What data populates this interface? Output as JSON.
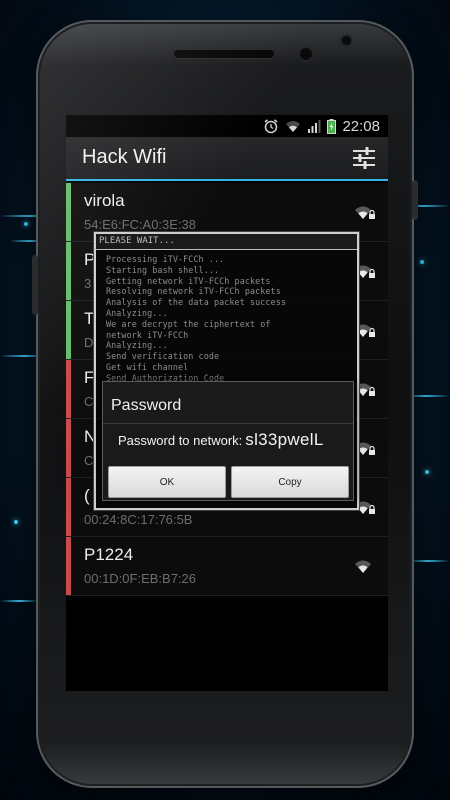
{
  "status_bar": {
    "time": "22:08",
    "icons": [
      "alarm-icon",
      "wifi-icon",
      "signal-icon",
      "battery-icon"
    ]
  },
  "app": {
    "title": "Hack Wifi",
    "settings_icon": "sliders-icon",
    "accent": "#33b5e5"
  },
  "networks": [
    {
      "name": "virola",
      "mac": "54:E6:FC:A0:3E:38",
      "status_color": "#66bb6a",
      "locked": true
    },
    {
      "name": "P",
      "mac": "3",
      "status_color": "#66bb6a",
      "locked": true
    },
    {
      "name": "T",
      "mac": "D",
      "status_color": "#66bb6a",
      "locked": true
    },
    {
      "name": "F",
      "mac": "C",
      "status_color": "#c94a4a",
      "locked": true
    },
    {
      "name": "N",
      "mac": "C",
      "status_color": "#c94a4a",
      "locked": true
    },
    {
      "name": "(",
      "mac": "00:24:8C:17:76:5B",
      "status_color": "#c94a4a",
      "locked": true
    },
    {
      "name": "P1224",
      "mac": "00:1D:0F:EB:B7:26",
      "status_color": "#c94a4a",
      "locked": false
    }
  ],
  "terminal": {
    "header": "PLEASE WAIT...",
    "lines": [
      "Processing iTV-FCCh ...",
      "Starting bash shell...",
      "Getting network iTV-FCCh packets",
      "Resolving network iTV-FCCh packets",
      "Analysis of the data packet success",
      "Analyzing...",
      "We are decrypt the ciphertext of",
      "network iTV-FCCh",
      "Analyzing...",
      "Send verification code",
      "Get wifi channel",
      "Send Authorization Code"
    ]
  },
  "dialog": {
    "title": "Password",
    "message_label": "Password to network:",
    "password": "sl33pwelL",
    "ok_label": "OK",
    "copy_label": "Copy"
  }
}
